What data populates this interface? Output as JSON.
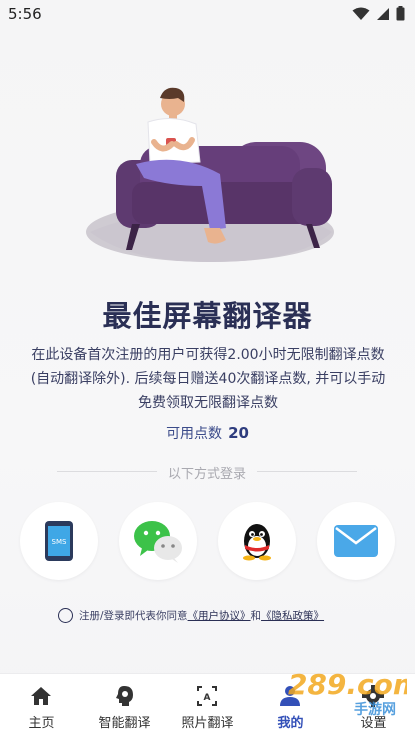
{
  "status_bar": {
    "time": "5:56"
  },
  "title": "最佳屏幕翻译器",
  "description": "在此设备首次注册的用户可获得2.00小时无限制翻译点数(自动翻译除外). 后续每日赠送40次翻译点数, 并可以手动免费领取无限翻译点数",
  "points": {
    "label": "可用点数",
    "value": "20"
  },
  "login": {
    "divider_text": "以下方式登录",
    "methods": [
      {
        "name": "sms",
        "icon": "sms-phone-icon"
      },
      {
        "name": "wechat",
        "icon": "wechat-icon"
      },
      {
        "name": "qq",
        "icon": "qq-penguin-icon"
      },
      {
        "name": "email",
        "icon": "email-icon"
      }
    ]
  },
  "agreement": {
    "prefix": "注册/登录即代表你同意",
    "user_agreement": "《用户协议》",
    "and": "和",
    "privacy_policy": "《隐私政策》"
  },
  "tabs": [
    {
      "label": "主页",
      "icon": "home-icon",
      "active": false
    },
    {
      "label": "智能翻译",
      "icon": "smart-translate-icon",
      "active": false
    },
    {
      "label": "照片翻译",
      "icon": "photo-translate-icon",
      "active": false
    },
    {
      "label": "我的",
      "icon": "profile-icon",
      "active": true
    },
    {
      "label": "设置",
      "icon": "settings-icon",
      "active": false
    }
  ],
  "watermark": {
    "text": "289.com",
    "sub": "手游网"
  },
  "colors": {
    "primary": "#2a2f55",
    "accent": "#3350b8",
    "sofa": "#5b3a6e"
  }
}
